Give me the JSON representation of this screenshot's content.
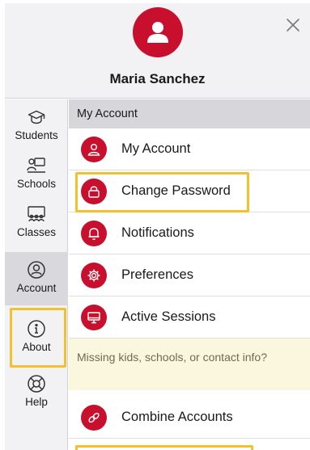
{
  "profile": {
    "name": "Maria Sanchez"
  },
  "sidebar": {
    "items": [
      {
        "label": "Students",
        "icon": "graduation-cap-icon"
      },
      {
        "label": "Schools",
        "icon": "school-icon"
      },
      {
        "label": "Classes",
        "icon": "classroom-icon"
      },
      {
        "label": "Account",
        "icon": "account-icon",
        "active": true
      },
      {
        "label": "About",
        "icon": "info-icon"
      },
      {
        "label": "Help",
        "icon": "lifebuoy-icon"
      }
    ]
  },
  "main": {
    "section_title": "My Account",
    "rows": [
      {
        "label": "My Account",
        "icon": "person-icon"
      },
      {
        "label": "Change Password",
        "icon": "lock-icon"
      },
      {
        "label": "Notifications",
        "icon": "bell-icon"
      },
      {
        "label": "Preferences",
        "icon": "gear-icon"
      },
      {
        "label": "Active Sessions",
        "icon": "monitor-icon"
      }
    ],
    "notice": "Missing kids, schools, or contact info?",
    "extra_rows": [
      {
        "label": "Combine Accounts",
        "icon": "link-icon"
      }
    ]
  },
  "colors": {
    "accent": "#c8102e",
    "highlight": "#f2c12e",
    "sidebar_bg": "#f2f2f4",
    "section_bg": "#d7d7db",
    "notice_bg": "#fbf6de"
  }
}
